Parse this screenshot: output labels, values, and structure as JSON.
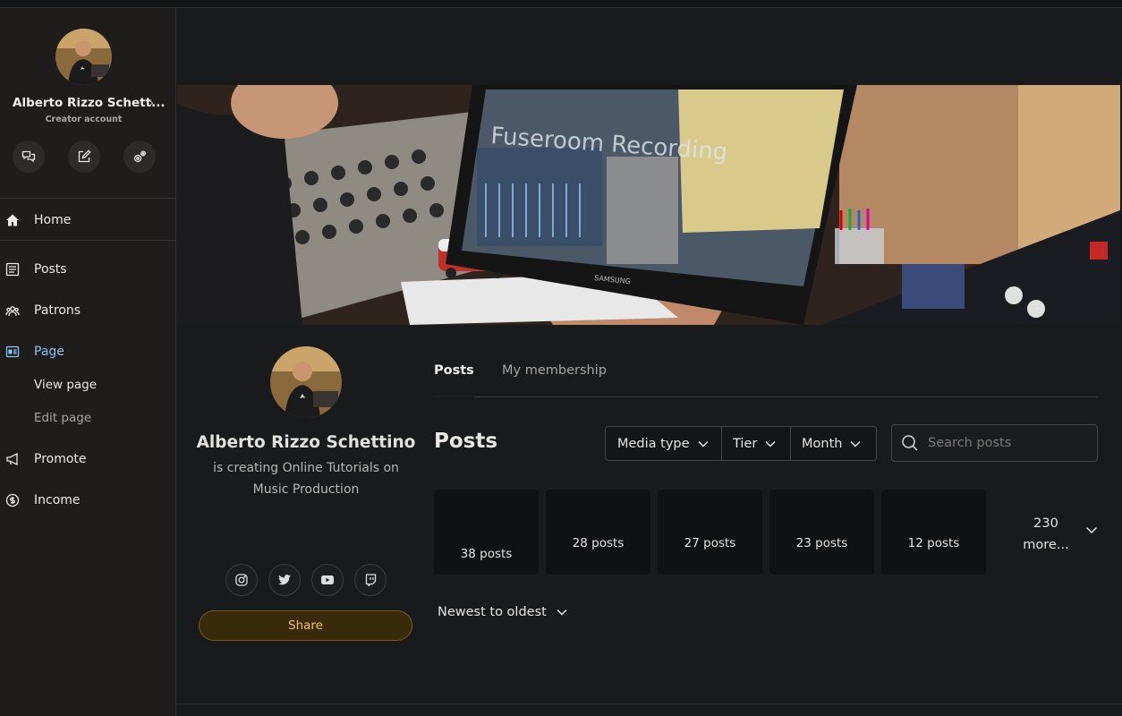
{
  "sidebar": {
    "profile_name": "Alberto Rizzo Schett...",
    "account_type": "Creator account",
    "quick_actions": [
      {
        "label": "messages",
        "icon": "chat-bubbles-icon"
      },
      {
        "label": "create post",
        "icon": "edit-icon"
      },
      {
        "label": "settings",
        "icon": "settings-gear-icon"
      }
    ],
    "nav": {
      "home": "Home",
      "posts": "Posts",
      "patrons": "Patrons",
      "page": "Page",
      "view_page": "View page",
      "edit_page": "Edit page",
      "promote": "Promote",
      "income": "Income"
    },
    "active_color": "#8bc2f0"
  },
  "banner": {
    "screen_text": "Fuseroom Recording",
    "monitor_brand": "SAMSUNG"
  },
  "profile": {
    "name": "Alberto Rizzo Schettino",
    "description": "is creating Online Tutorials on Music Production",
    "share_label": "Share",
    "socials": [
      "instagram",
      "twitter",
      "youtube",
      "twitch"
    ]
  },
  "tabs": {
    "posts": "Posts",
    "membership": "My membership"
  },
  "posts_section": {
    "title": "Posts",
    "filters": {
      "media_type": "Media type",
      "tier": "Tier",
      "month": "Month"
    },
    "search_placeholder": "Search posts",
    "cards": [
      "38 posts",
      "28 posts",
      "27 posts",
      "23 posts",
      "12 posts"
    ],
    "more_count": "230",
    "more_label": "more...",
    "sort_label": "Newest to oldest"
  },
  "colors": {
    "share_bg": "#3a2a0c",
    "share_text": "#f3c25c"
  }
}
